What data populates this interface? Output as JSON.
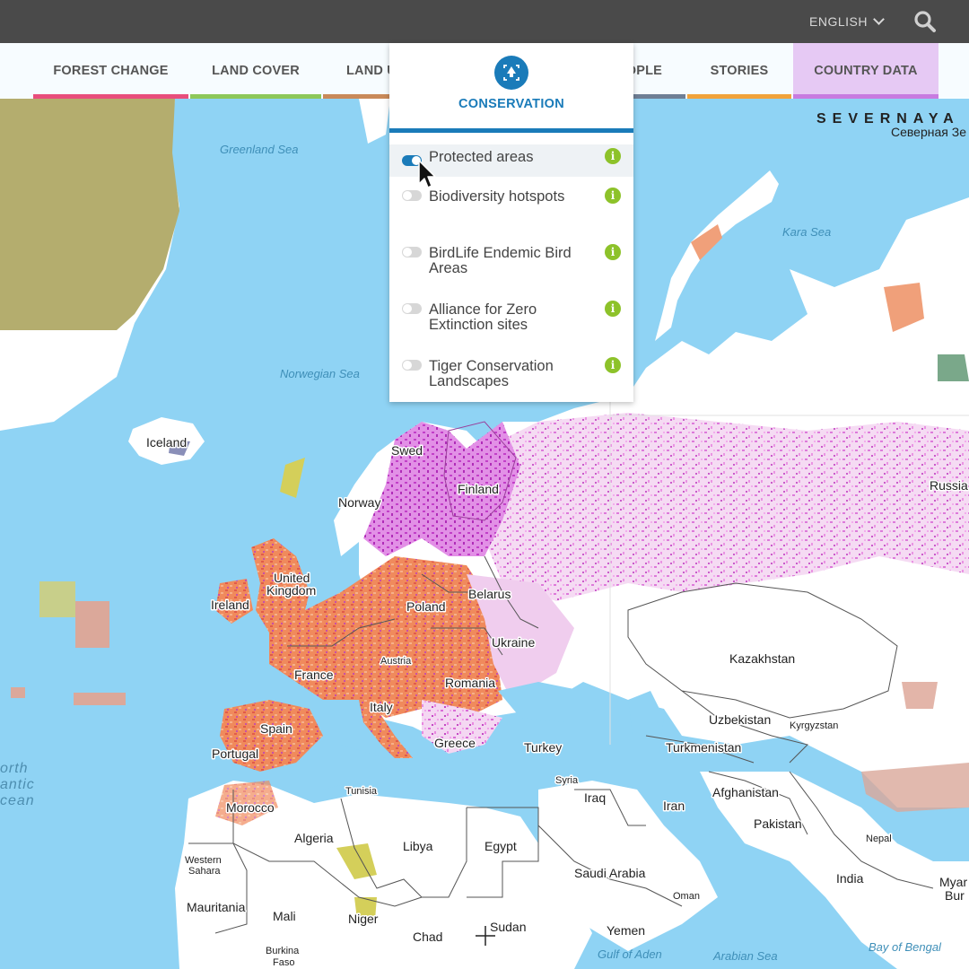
{
  "topbar": {
    "language": "ENGLISH",
    "search_icon": "search-icon"
  },
  "menu": {
    "tabs": [
      {
        "label": "FOREST CHANGE",
        "color": "#e84e7c"
      },
      {
        "label": "LAND COVER",
        "color": "#8dc85a"
      },
      {
        "label": "LAND U",
        "color": "#c98a5a"
      },
      {
        "label": "OPLE",
        "color": "#6f7f95"
      },
      {
        "label": "STORIES",
        "color": "#f1a33b"
      },
      {
        "label": "COUNTRY DATA",
        "color": "#c87be0"
      }
    ]
  },
  "conservation": {
    "title": "CONSERVATION",
    "icon": "conservation-icon",
    "accent": "#1a7bb9",
    "layers": [
      {
        "label": "Protected areas",
        "on": true
      },
      {
        "label": "Biodiversity hotspots",
        "on": false
      },
      {
        "label": "BirdLife Endemic Bird Areas",
        "on": false
      },
      {
        "label": "Alliance for Zero Extinction sites",
        "on": false
      },
      {
        "label": "Tiger Conservation Landscapes",
        "on": false
      }
    ]
  },
  "map": {
    "region_label": "SEVERNAYA",
    "region_label_ru": "Северная Зе",
    "water": {
      "greenland_sea": "Greenland Sea",
      "norwegian_sea": "Norwegian Sea",
      "kara_sea": "Kara Sea",
      "gulf_of_aden": "Gulf of Aden",
      "arabian_sea": "Arabian Sea",
      "bay_of_bengal": "Bay of Bengal"
    },
    "ocean_lines": [
      "orth",
      "antic",
      "cean"
    ],
    "countries": {
      "iceland": "Iceland",
      "sweden": "Swed",
      "finland": "Finland",
      "norway": "Norway",
      "russia": "Russia",
      "uk_line1": "United",
      "uk_line2": "Kingdom",
      "ireland": "Ireland",
      "belarus": "Belarus",
      "poland": "Poland",
      "ukraine": "Ukraine",
      "kazakhstan": "Kazakhstan",
      "france": "France",
      "austria": "Austria",
      "romania": "Romania",
      "italy": "Italy",
      "spain": "Spain",
      "portugal": "Portugal",
      "greece": "Greece",
      "turkey": "Turkey",
      "uzbekistan": "Uzbekistan",
      "kyrgyzstan": "Kyrgyzstan",
      "turkmenistan": "Turkmenistan",
      "syria": "Syria",
      "tunisia": "Tunisia",
      "iraq": "Iraq",
      "afghanistan": "Afghanistan",
      "iran": "Iran",
      "morocco": "Morocco",
      "algeria": "Algeria",
      "libya": "Libya",
      "egypt": "Egypt",
      "pakistan": "Pakistan",
      "nepal": "Nepal",
      "western_sahara_line1": "Western",
      "western_sahara_line2": "Sahara",
      "saudi_arabia": "Saudi Arabia",
      "india": "India",
      "oman": "Oman",
      "myanmar_line1": "Myar",
      "myanmar_line2": "Bur",
      "mauritania": "Mauritania",
      "mali": "Mali",
      "niger": "Niger",
      "sudan": "Sudan",
      "chad": "Chad",
      "yemen": "Yemen",
      "burkina_line1": "Burkina",
      "burkina_line2": "Faso"
    }
  }
}
